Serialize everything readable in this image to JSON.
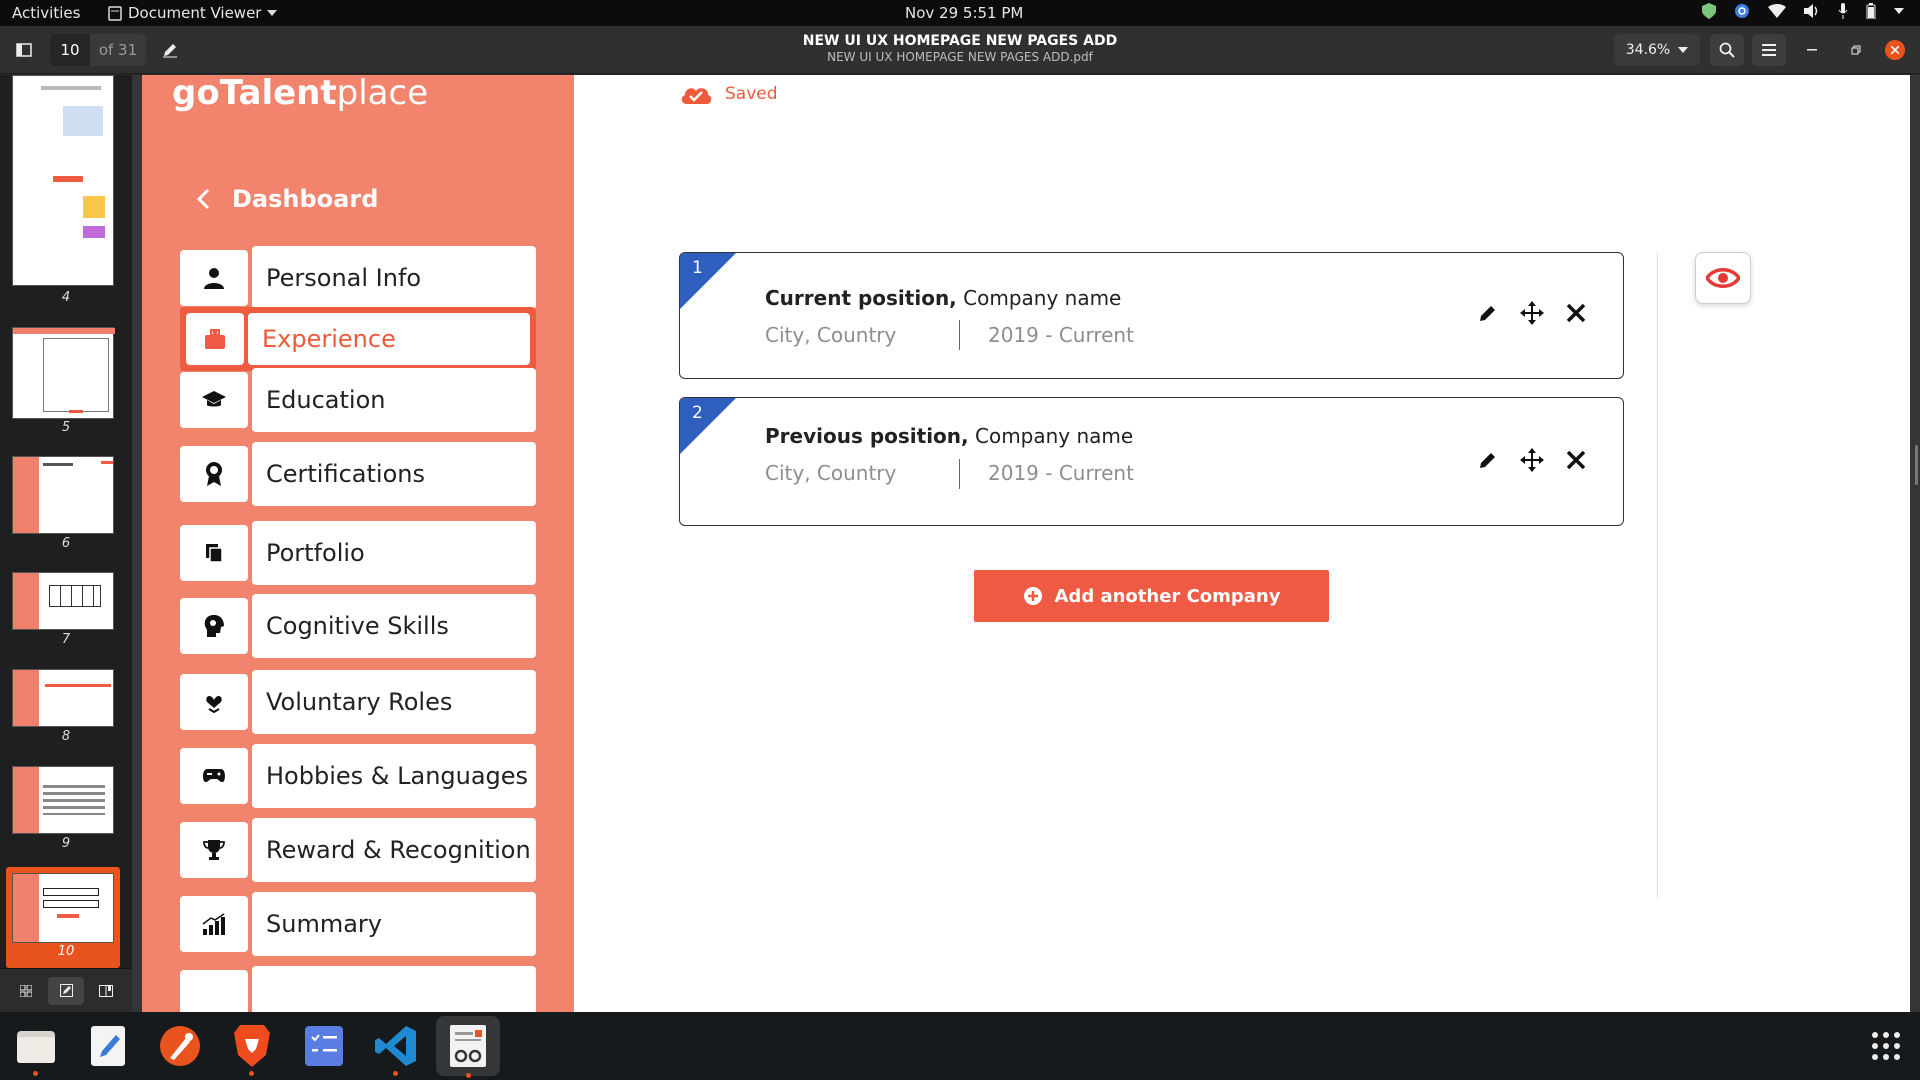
{
  "topbar": {
    "activities": "Activities",
    "app_name": "Document Viewer",
    "clock": "Nov 29   5:51 PM"
  },
  "headerbar": {
    "page_current": "10",
    "page_total": "of 31",
    "title": "NEW  UI UX HOMEPAGE NEW PAGES ADD",
    "subtitle": "NEW  UI UX HOMEPAGE NEW PAGES ADD.pdf",
    "zoom": "34.6%"
  },
  "thumbnails": [
    {
      "num": "4"
    },
    {
      "num": "5"
    },
    {
      "num": "6"
    },
    {
      "num": "7"
    },
    {
      "num": "8"
    },
    {
      "num": "9"
    },
    {
      "num": "10"
    }
  ],
  "page": {
    "logo_go": "go",
    "logo_talent": "Talent",
    "logo_place": "place",
    "dashboard": "Dashboard",
    "saved": "Saved",
    "menu": [
      {
        "label": "Personal Info",
        "icon": "person-icon"
      },
      {
        "label": "Experience",
        "icon": "briefcase-icon"
      },
      {
        "label": "Education",
        "icon": "graduation-cap-icon"
      },
      {
        "label": "Certifications",
        "icon": "award-icon"
      },
      {
        "label": "Portfolio",
        "icon": "portfolio-icon"
      },
      {
        "label": "Cognitive Skills",
        "icon": "brain-icon"
      },
      {
        "label": "Voluntary Roles",
        "icon": "heart-hand-icon"
      },
      {
        "label": "Hobbies & Languages",
        "icon": "gamepad-icon"
      },
      {
        "label": "Reward & Recognition",
        "icon": "trophy-icon"
      },
      {
        "label": "Summary",
        "icon": "chart-icon"
      }
    ],
    "cards": [
      {
        "num": "1",
        "title_bold": "Current position,",
        "title_rest": " Company name",
        "location": "City, Country",
        "dates": "2019 - Current"
      },
      {
        "num": "2",
        "title_bold": "Previous position,",
        "title_rest": " Company name",
        "location": "City, Country",
        "dates": "2019 - Current"
      }
    ],
    "add_button": "Add another Company"
  },
  "colors": {
    "accent": "#ef5a44",
    "sidebar": "#f2836d",
    "corner_blue": "#2f5fbe",
    "dock_active": "#e9541e"
  }
}
